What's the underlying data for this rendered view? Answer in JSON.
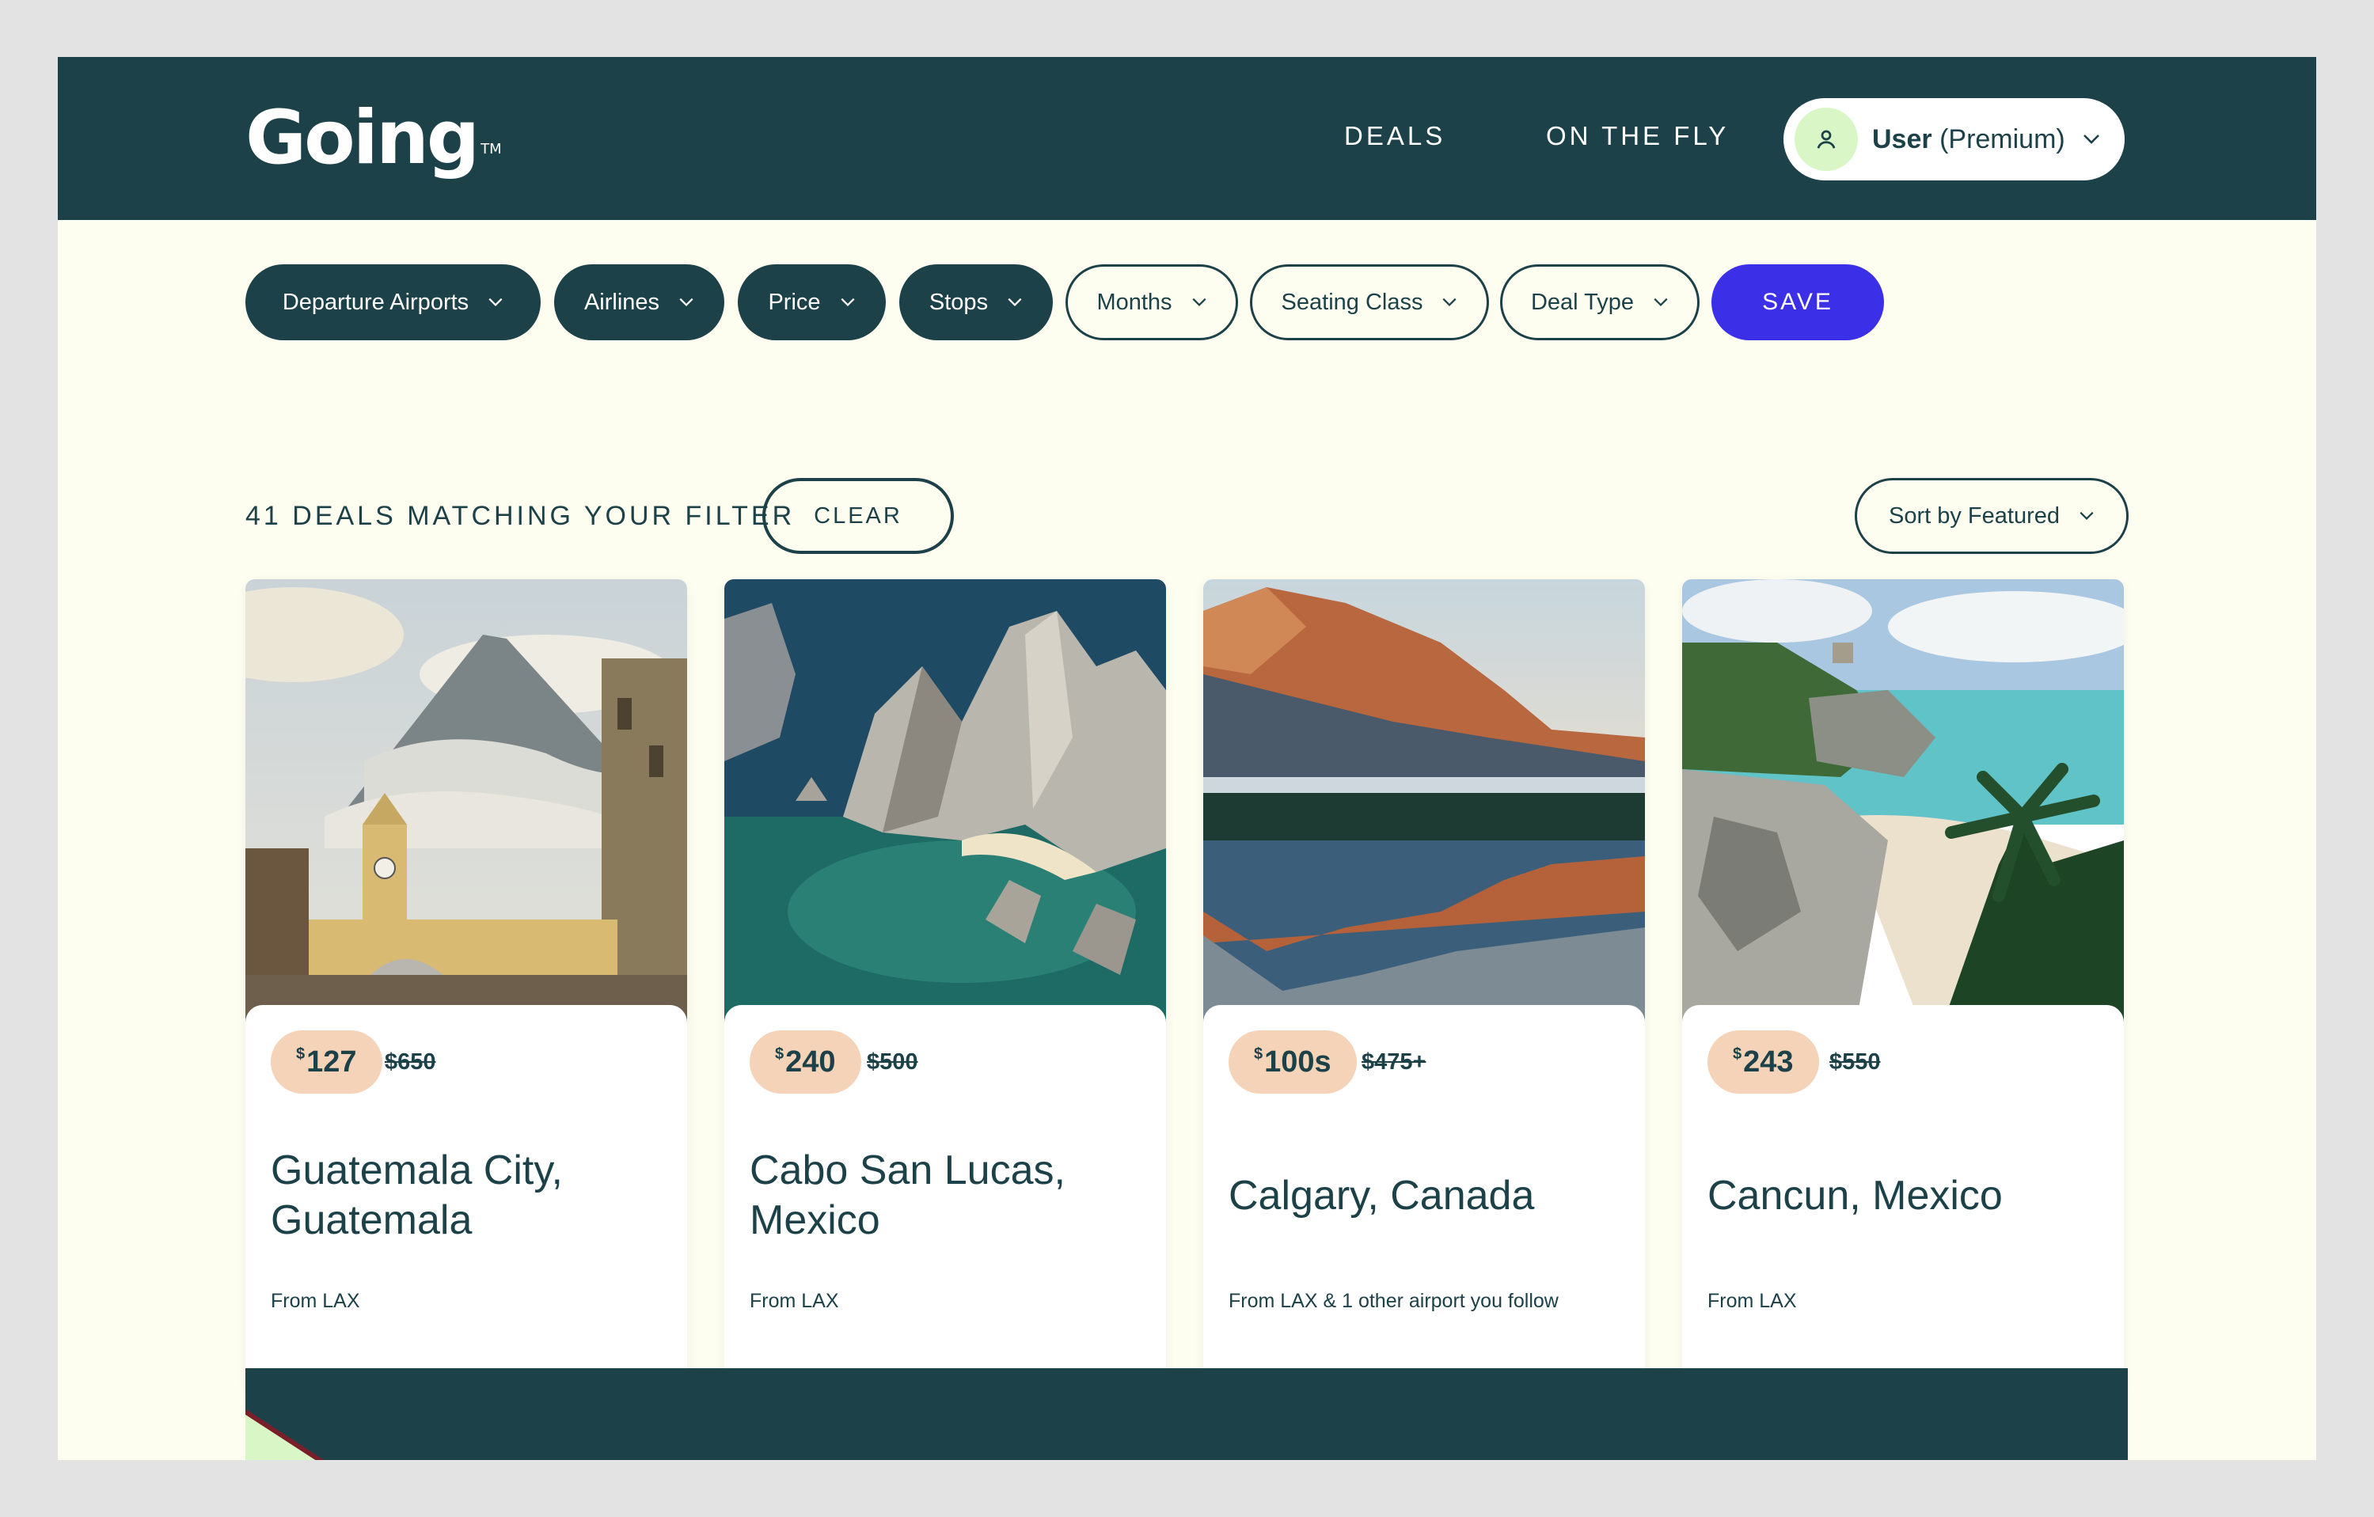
{
  "header": {
    "logo": "Going",
    "logo_tm": "TM",
    "nav": {
      "deals": "DEALS",
      "on_the_fly": "ON THE FLY"
    },
    "user": {
      "name": "User",
      "plan": "(Premium)"
    }
  },
  "filters": [
    {
      "label": "Departure Airports",
      "style": "dark"
    },
    {
      "label": "Airlines",
      "style": "dark"
    },
    {
      "label": "Price",
      "style": "dark"
    },
    {
      "label": "Stops",
      "style": "dark"
    },
    {
      "label": "Months",
      "style": "light"
    },
    {
      "label": "Seating Class",
      "style": "light"
    },
    {
      "label": "Deal Type",
      "style": "light"
    }
  ],
  "save_label": "SAVE",
  "results": {
    "count_text": "41 DEALS MATCHING YOUR FILTER",
    "clear_label": "CLEAR",
    "sort_label": "Sort by Featured"
  },
  "deals": [
    {
      "currency": "$",
      "price": "127",
      "old_price": "$650",
      "destination_line1": "Guatemala City,",
      "destination_line2": "Guatemala",
      "from": "From LAX",
      "image_icon": "guatemala-arch-volcano"
    },
    {
      "currency": "$",
      "price": "240",
      "old_price": "$500",
      "destination_line1": "Cabo San Lucas,",
      "destination_line2": "Mexico",
      "from": "From LAX",
      "image_icon": "cabo-rocks-sea"
    },
    {
      "currency": "$",
      "price": "100s",
      "old_price": "$475+",
      "destination_line1": "Calgary, Canada",
      "destination_line2": "",
      "from": "From LAX & 1 other airport you follow",
      "image_icon": "calgary-mountain-lake"
    },
    {
      "currency": "$",
      "price": "243",
      "old_price": "$550",
      "destination_line1": "Cancun, Mexico",
      "destination_line2": "",
      "from": "From LAX",
      "image_icon": "cancun-beach-palm"
    }
  ],
  "colors": {
    "brand_dark": "#1c4148",
    "cream_bg": "#fdfdf0",
    "save_blue": "#3b30e8",
    "price_pill": "#f5d3b8",
    "avatar_green": "#d9f6c6"
  }
}
